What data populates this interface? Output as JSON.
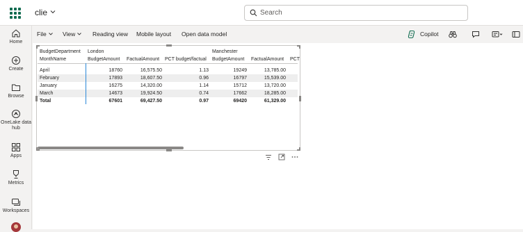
{
  "app": {
    "workspace_name": "clie",
    "search_placeholder": "Search",
    "icons": [
      "waffle-icon",
      "chevron-down-icon",
      "search-icon"
    ]
  },
  "nav": {
    "items": [
      {
        "label": "Home",
        "icon": "home-icon"
      },
      {
        "label": "Create",
        "icon": "create-icon"
      },
      {
        "label": "Browse",
        "icon": "browse-icon"
      },
      {
        "label": "OneLake data hub",
        "icon": "onelake-icon"
      },
      {
        "label": "Apps",
        "icon": "apps-icon"
      },
      {
        "label": "Metrics",
        "icon": "metrics-icon"
      },
      {
        "label": "Workspaces",
        "icon": "workspaces-icon"
      }
    ]
  },
  "menu": {
    "file": "File",
    "view": "View",
    "reading_view": "Reading view",
    "mobile_layout": "Mobile layout",
    "open_data_model": "Open data model",
    "copilot": "Copilot"
  },
  "matrix": {
    "column_field": "BudgetDepartment",
    "row_field": "MonthName",
    "groups": [
      "London",
      "Manchester"
    ],
    "measures": [
      "BudgetAmount",
      "FactualAmount",
      "PCT budget/factual"
    ],
    "visible_headers": [
      "BudgetAmount",
      "FactualAmount",
      "PCT budget/factual",
      "BudgetAmount",
      "FactualAmount",
      "PCT"
    ],
    "rows": [
      {
        "month": "April",
        "london_budget": "18760",
        "london_factual": "16,575.50",
        "london_pct": "1.13",
        "manchester_budget": "19249",
        "manchester_factual": "13,785.00"
      },
      {
        "month": "February",
        "london_budget": "17893",
        "london_factual": "18,607.50",
        "london_pct": "0.96",
        "manchester_budget": "16797",
        "manchester_factual": "15,539.00"
      },
      {
        "month": "January",
        "london_budget": "16275",
        "london_factual": "14,320.00",
        "london_pct": "1.14",
        "manchester_budget": "15712",
        "manchester_factual": "13,720.00"
      },
      {
        "month": "March",
        "london_budget": "14673",
        "london_factual": "19,924.50",
        "london_pct": "0.74",
        "manchester_budget": "17662",
        "manchester_factual": "18,285.00"
      }
    ],
    "total": {
      "month": "Total",
      "london_budget": "67601",
      "london_factual": "69,427.50",
      "london_pct": "0.97",
      "manchester_budget": "69420",
      "manchester_factual": "61,329.00"
    }
  },
  "visual_header_icons": [
    "filter-icon",
    "focus-mode-icon",
    "more-options-icon"
  ]
}
